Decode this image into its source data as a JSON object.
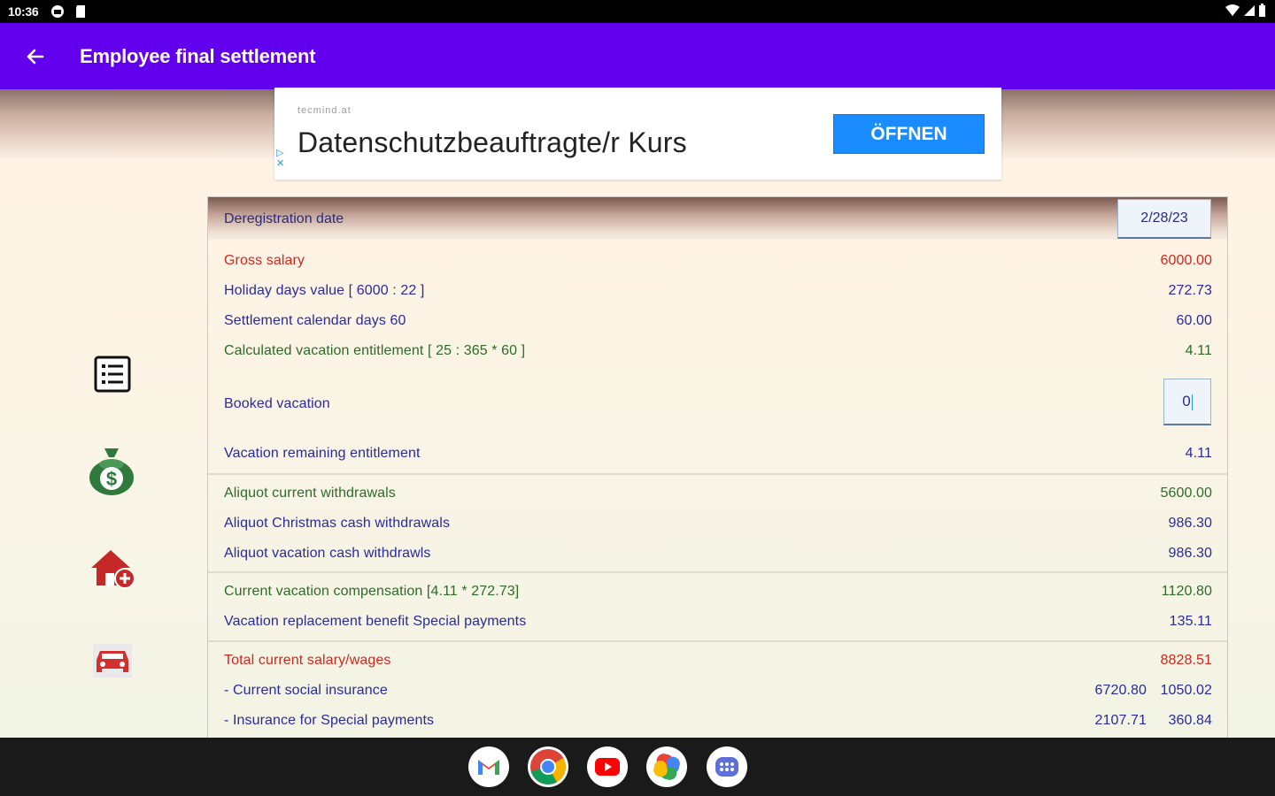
{
  "status_bar": {
    "time": "10:36"
  },
  "app_bar": {
    "title": "Employee final settlement"
  },
  "ad": {
    "sponsor": "tecmind.at",
    "headline": "Datenschutzbeauftragte/r Kurs",
    "button_label": "ÖFFNEN"
  },
  "card": {
    "deregistration_label": "Deregistration date",
    "deregistration_date": "2/28/23",
    "rows": [
      {
        "label": "Gross salary",
        "value": "6000.00",
        "color": "#d0271e"
      },
      {
        "label": "Holiday days value [ 6000 : 22 ]",
        "value": "272.73",
        "color": "#2b2a9a"
      },
      {
        "label": "Settlement calendar days 60",
        "value": "60.00",
        "color": "#2b2a9a"
      },
      {
        "label": "Calculated vacation entitlement [ 25 : 365 * 60 ]",
        "value": "4.11",
        "color": "#2e6b2a"
      },
      {
        "label": "Booked vacation",
        "value": "0",
        "color": "#2b2a9a"
      },
      {
        "label": "Vacation remaining entitlement",
        "value": "4.11",
        "color": "#2b2a9a"
      },
      {
        "label": "Aliquot current withdrawals",
        "value": "5600.00",
        "color": "#2e6b2a"
      },
      {
        "label": "Aliquot Christmas cash withdrawals",
        "value": "986.30",
        "color": "#2b2a9a"
      },
      {
        "label": "Aliquot vacation cash withdrawls",
        "value": "986.30",
        "color": "#2b2a9a"
      },
      {
        "label": "Current vacation compensation [4.11 * 272.73]",
        "value": "1120.80",
        "color": "#2e6b2a"
      },
      {
        "label": "Vacation replacement benefit Special payments",
        "value": "135.11",
        "color": "#2b2a9a"
      },
      {
        "label": "Total current salary/wages",
        "value": "8828.51",
        "color": "#d0271e"
      },
      {
        "label": "- Current social insurance",
        "value_a": "6720.80",
        "value": "1050.02",
        "color": "#2b2a9a"
      },
      {
        "label": "- Insurance for Special payments",
        "value_a": "2107.71",
        "value": "360.84",
        "color": "#2b2a9a"
      }
    ]
  },
  "side_icons": [
    "list-icon",
    "money-bag-icon",
    "house-add-icon",
    "car-icon"
  ],
  "dock": [
    "gmail-icon",
    "chrome-icon",
    "youtube-icon",
    "photos-icon",
    "app-drawer-icon"
  ]
}
